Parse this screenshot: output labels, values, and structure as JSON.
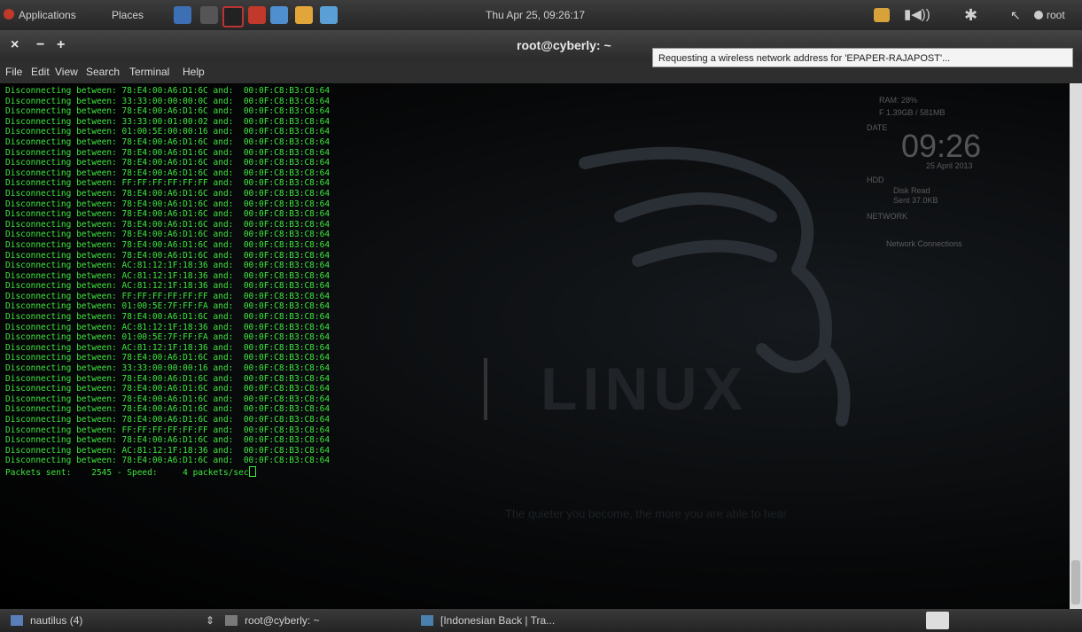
{
  "top_panel": {
    "applications_label": "Applications",
    "places_label": "Places",
    "clock": "Thu Apr 25, 09:26:17",
    "user": "root"
  },
  "window": {
    "title": "root@cyberly: ~",
    "close": "×",
    "minimize": "−",
    "maximize": "+"
  },
  "menu": [
    "File",
    "Edit",
    "View",
    "Search",
    "Terminal",
    "Help"
  ],
  "tooltip": "Requesting a wireless network address for 'EPAPER-RAJAPOST'...",
  "terminal": {
    "prefix": "Disconnecting between:",
    "conj": "and:",
    "lines": [
      [
        "78:E4:00:A6:D1:6C",
        "00:0F:C8:B3:C8:64"
      ],
      [
        "33:33:00:00:00:0C",
        "00:0F:C8:B3:C8:64"
      ],
      [
        "78:E4:00:A6:D1:6C",
        "00:0F:C8:B3:C8:64"
      ],
      [
        "33:33:00:01:00:02",
        "00:0F:C8:B3:C8:64"
      ],
      [
        "01:00:5E:00:00:16",
        "00:0F:C8:B3:C8:64"
      ],
      [
        "78:E4:00:A6:D1:6C",
        "00:0F:C8:B3:C8:64"
      ],
      [
        "78:E4:00:A6:D1:6C",
        "00:0F:C8:B3:C8:64"
      ],
      [
        "78:E4:00:A6:D1:6C",
        "00:0F:C8:B3:C8:64"
      ],
      [
        "78:E4:00:A6:D1:6C",
        "00:0F:C8:B3:C8:64"
      ],
      [
        "FF:FF:FF:FF:FF:FF",
        "00:0F:C8:B3:C8:64"
      ],
      [
        "78:E4:00:A6:D1:6C",
        "00:0F:C8:B3:C8:64"
      ],
      [
        "78:E4:00:A6:D1:6C",
        "00:0F:C8:B3:C8:64"
      ],
      [
        "78:E4:00:A6:D1:6C",
        "00:0F:C8:B3:C8:64"
      ],
      [
        "78:E4:00:A6:D1:6C",
        "00:0F:C8:B3:C8:64"
      ],
      [
        "78:E4:00:A6:D1:6C",
        "00:0F:C8:B3:C8:64"
      ],
      [
        "78:E4:00:A6:D1:6C",
        "00:0F:C8:B3:C8:64"
      ],
      [
        "78:E4:00:A6:D1:6C",
        "00:0F:C8:B3:C8:64"
      ],
      [
        "AC:81:12:1F:18:36",
        "00:0F:C8:B3:C8:64"
      ],
      [
        "AC:81:12:1F:18:36",
        "00:0F:C8:B3:C8:64"
      ],
      [
        "AC:81:12:1F:18:36",
        "00:0F:C8:B3:C8:64"
      ],
      [
        "FF:FF:FF:FF:FF:FF",
        "00:0F:C8:B3:C8:64"
      ],
      [
        "01:00:5E:7F:FF:FA",
        "00:0F:C8:B3:C8:64"
      ],
      [
        "78:E4:00:A6:D1:6C",
        "00:0F:C8:B3:C8:64"
      ],
      [
        "AC:81:12:1F:18:36",
        "00:0F:C8:B3:C8:64"
      ],
      [
        "01:00:5E:7F:FF:FA",
        "00:0F:C8:B3:C8:64"
      ],
      [
        "AC:81:12:1F:18:36",
        "00:0F:C8:B3:C8:64"
      ],
      [
        "78:E4:00:A6:D1:6C",
        "00:0F:C8:B3:C8:64"
      ],
      [
        "33:33:00:00:00:16",
        "00:0F:C8:B3:C8:64"
      ],
      [
        "78:E4:00:A6:D1:6C",
        "00:0F:C8:B3:C8:64"
      ],
      [
        "78:E4:00:A6:D1:6C",
        "00:0F:C8:B3:C8:64"
      ],
      [
        "78:E4:00:A6:D1:6C",
        "00:0F:C8:B3:C8:64"
      ],
      [
        "78:E4:00:A6:D1:6C",
        "00:0F:C8:B3:C8:64"
      ],
      [
        "78:E4:00:A6:D1:6C",
        "00:0F:C8:B3:C8:64"
      ],
      [
        "FF:FF:FF:FF:FF:FF",
        "00:0F:C8:B3:C8:64"
      ],
      [
        "78:E4:00:A6:D1:6C",
        "00:0F:C8:B3:C8:64"
      ],
      [
        "AC:81:12:1F:18:36",
        "00:0F:C8:B3:C8:64"
      ],
      [
        "78:E4:00:A6:D1:6C",
        "00:0F:C8:B3:C8:64"
      ]
    ],
    "status_line": "Packets sent:    2545 - Speed:     4 packets/sec"
  },
  "wallpaper": {
    "brand_text": "LINUX",
    "slogan": "The quieter you become, the more you are able to hear"
  },
  "conky": {
    "clock": "09:26",
    "date": "25 April 2013",
    "ram": "RAM: 28%",
    "ram_value": "F 1.39GB / 581MB",
    "date_label": "DATE",
    "hdd_label": "HDD",
    "disk_read": "Disk Read",
    "disk_sent": "Sent 37.0KB",
    "network_label": "NETWORK",
    "network_status": "Network Connections"
  },
  "taskbar": [
    {
      "label": "nautilus (4)",
      "color": "#5a7fb8"
    },
    {
      "label": "root@cyberly: ~",
      "color": "#7a7a7a"
    },
    {
      "label": "[Indonesian Back | Tra...",
      "color": "#4a7fae"
    }
  ],
  "colors": {
    "terminal_text": "#3ee73e",
    "panel": "#2f2f2f"
  }
}
